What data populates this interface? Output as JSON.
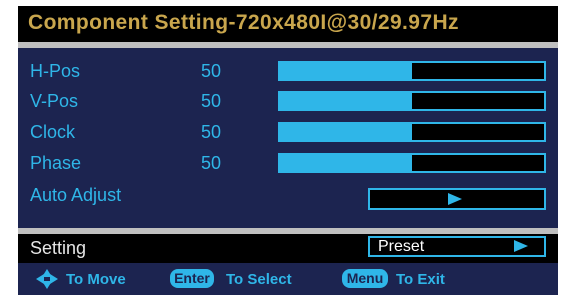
{
  "title": "Component Setting-720x480I@30/29.97Hz",
  "rows": [
    {
      "label": "H-Pos",
      "value": "50",
      "fraction": 0.5
    },
    {
      "label": "V-Pos",
      "value": "50",
      "fraction": 0.5
    },
    {
      "label": "Clock",
      "value": "50",
      "fraction": 0.5
    },
    {
      "label": "Phase",
      "value": "50",
      "fraction": 0.5
    }
  ],
  "auto_adjust": {
    "label": "Auto Adjust"
  },
  "setting": {
    "label": "Setting",
    "value": "Preset"
  },
  "hints": {
    "move": "To Move",
    "enter_key": "Enter",
    "select": "To Select",
    "menu_key": "Menu",
    "exit": "To Exit"
  },
  "colors": {
    "accent": "#2fb6e8",
    "title": "#c9a64d",
    "panel": "#1c2450",
    "background": "#000000"
  }
}
